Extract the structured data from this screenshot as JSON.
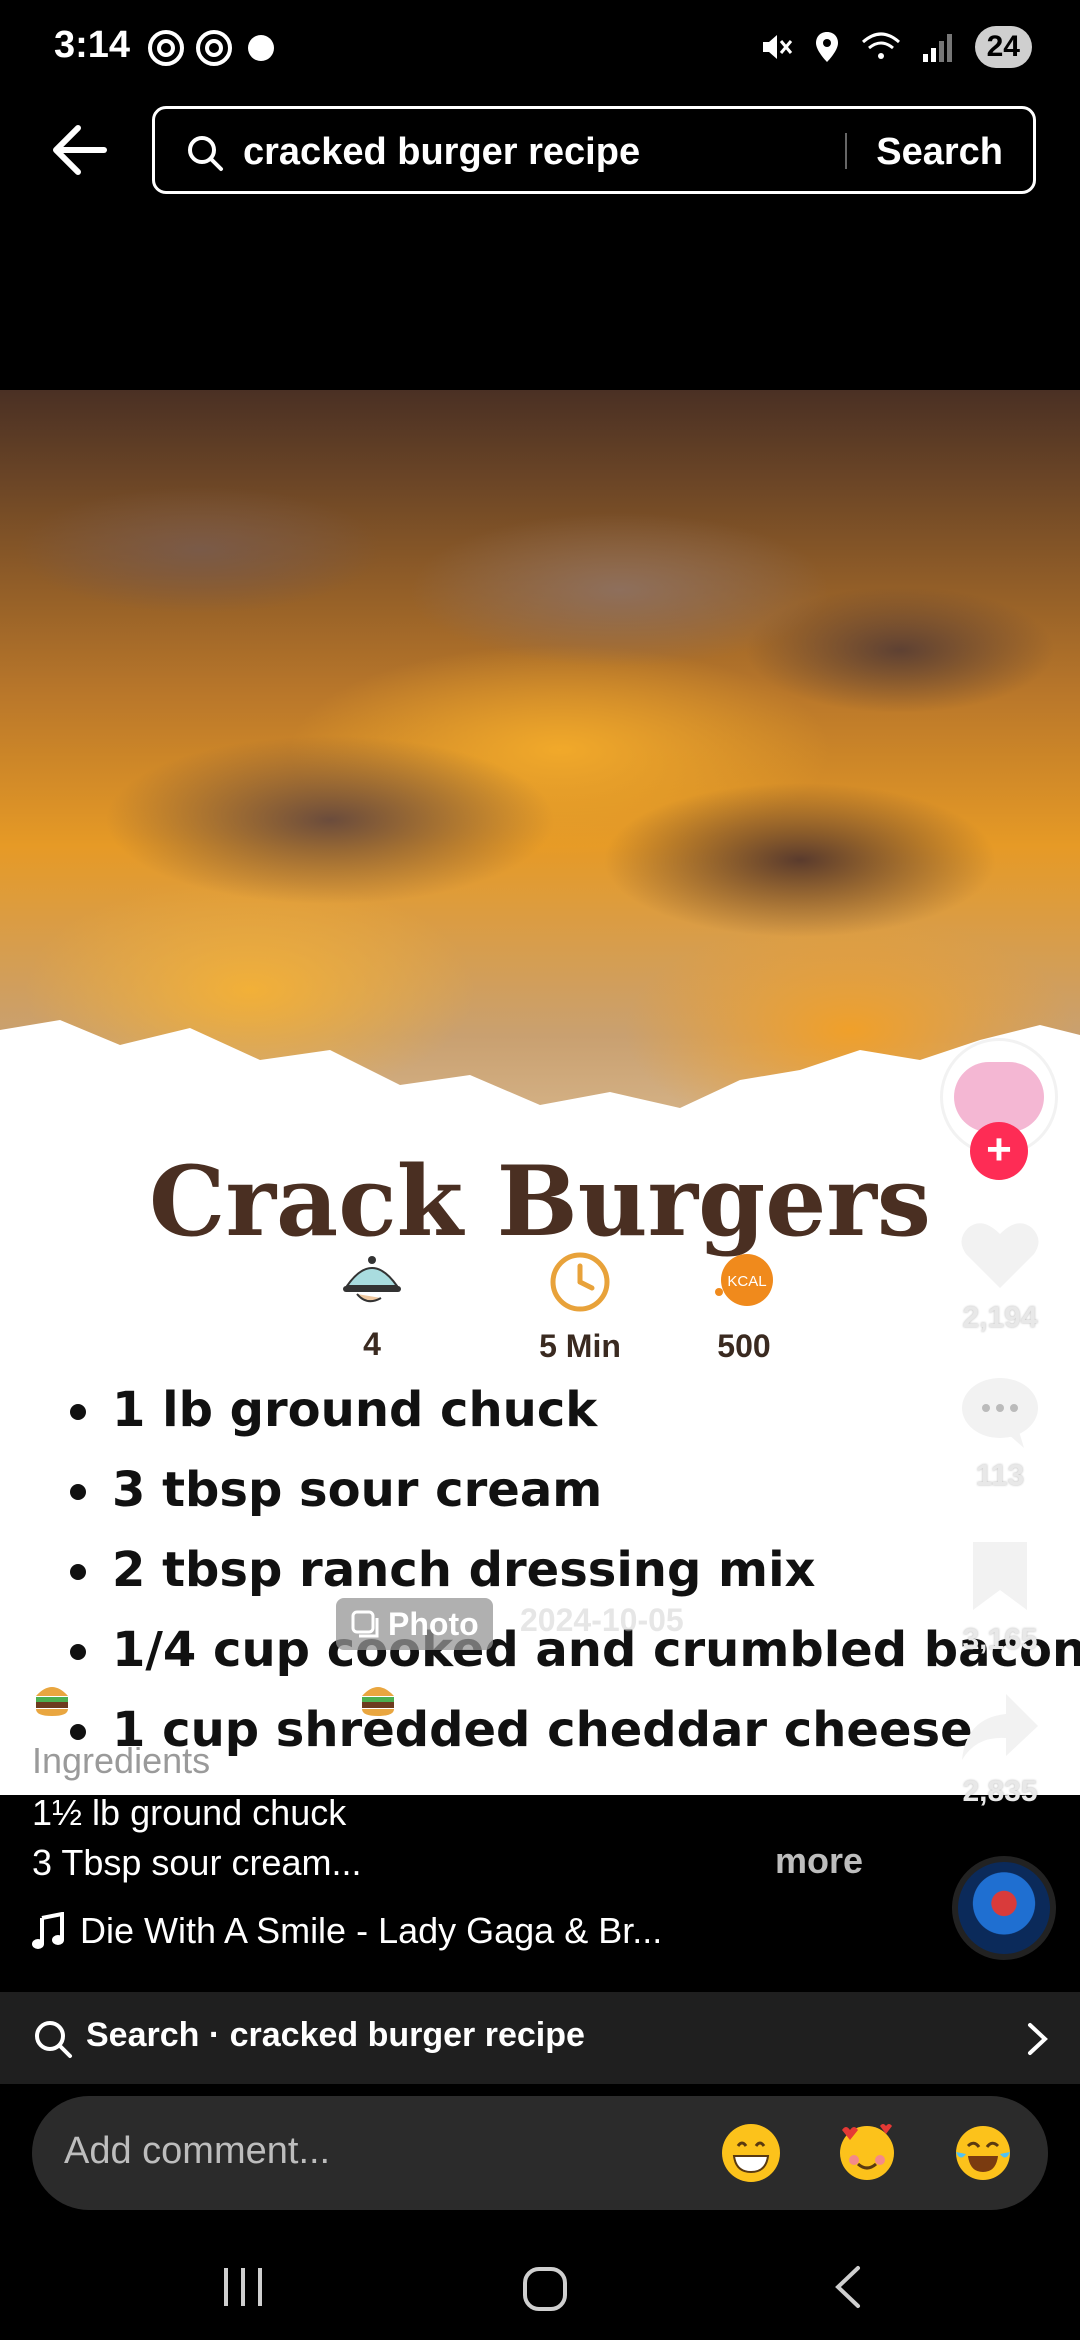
{
  "status_bar": {
    "time": "3:14",
    "battery": "24"
  },
  "search": {
    "query": "cracked burger recipe",
    "submit_label": "Search"
  },
  "post": {
    "title": "Crack Burgers",
    "stats": [
      {
        "icon": "cloche-icon",
        "value": "4"
      },
      {
        "icon": "clock-icon",
        "value": "5 Min"
      },
      {
        "icon": "kcal-icon",
        "icon_text": "KCAL",
        "value": "500"
      }
    ],
    "ingredients": [
      "1 lb ground chuck",
      "3 tbsp sour cream",
      "2 tbsp ranch dressing mix",
      "1/4 cup cooked and crumbled bacon",
      "1 cup shredded cheddar cheese"
    ],
    "photo_label": "Photo",
    "date": "2024-10-05",
    "caption": {
      "line1": "Ingredients",
      "line2": "1½ lb ground chuck",
      "line3": "3 Tbsp sour cream...",
      "more": "more"
    },
    "music": "Die With A Smile - Lady Gaga & Br..."
  },
  "actions": {
    "likes": "2,194",
    "comments": "113",
    "saves": "3,165",
    "shares": "2,835",
    "follow": "+"
  },
  "related_search": {
    "label": "Search · cracked burger recipe"
  },
  "comment": {
    "placeholder": "Add comment..."
  },
  "colors": {
    "accent": "#fe2c55",
    "title_brown": "#4a2f22",
    "clock_orange": "#e8a23a"
  }
}
